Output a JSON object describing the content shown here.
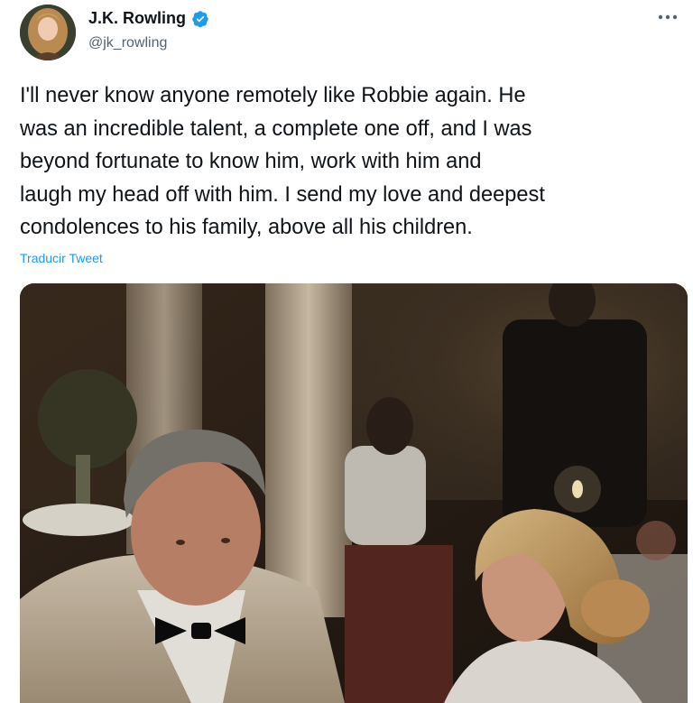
{
  "author": {
    "display_name": "J.K. Rowling",
    "handle": "@jk_rowling",
    "verified_icon": "verified-badge-icon",
    "avatar_icon": "avatar-photo"
  },
  "tweet": {
    "text_lines": [
      "I'll never know anyone remotely like Robbie again. He",
      "was an incredible talent, a complete one off, and I was",
      "beyond fortunate to know him, work with him and",
      "laugh my head off with him. I send my love and deepest",
      "condolences to his family, above all his children."
    ],
    "translate_label": "Traducir Tweet",
    "more_icon": "more-options-icon"
  },
  "colors": {
    "accent": "#1d9bf0",
    "text_primary": "#0f1419",
    "text_secondary": "#536471"
  }
}
